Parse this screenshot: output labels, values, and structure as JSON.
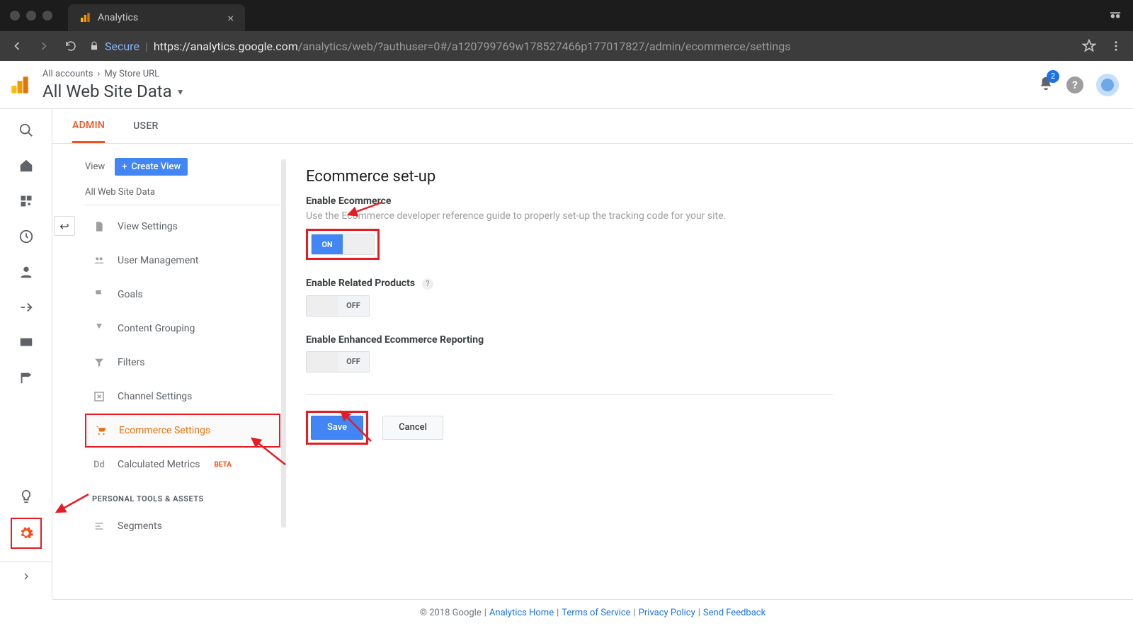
{
  "browser": {
    "tab_title": "Analytics",
    "url_secure_label": "Secure",
    "url_protocol": "https://",
    "url_domain": "analytics.google.com",
    "url_path": "/analytics/web/?authuser=0#/a120799769w178527466p177017827/admin/ecommerce/settings"
  },
  "header": {
    "breadcrumb_accounts": "All accounts",
    "breadcrumb_store": "My Store URL",
    "view_title": "All Web Site Data",
    "notif_count": "2"
  },
  "tabs": {
    "admin": "ADMIN",
    "user": "USER"
  },
  "viewcol": {
    "label": "View",
    "create_btn": "Create View",
    "view_name": "All Web Site Data",
    "items": [
      "View Settings",
      "User Management",
      "Goals",
      "Content Grouping",
      "Filters",
      "Channel Settings",
      "Ecommerce Settings",
      "Calculated Metrics"
    ],
    "beta": "BETA",
    "section_personal": "PERSONAL TOOLS & ASSETS",
    "segments": "Segments"
  },
  "main": {
    "title": "Ecommerce set-up",
    "enable_ecom_label": "Enable Ecommerce",
    "enable_ecom_desc": "Use the Ecommerce developer reference guide to properly set-up the tracking code for your site.",
    "toggle_on": "ON",
    "toggle_off": "OFF",
    "related_label": "Enable Related Products",
    "enhanced_label": "Enable Enhanced Ecommerce Reporting",
    "save": "Save",
    "cancel": "Cancel"
  },
  "footer": {
    "copyright": "© 2018 Google",
    "home": "Analytics Home",
    "tos": "Terms of Service",
    "privacy": "Privacy Policy",
    "feedback": "Send Feedback"
  }
}
